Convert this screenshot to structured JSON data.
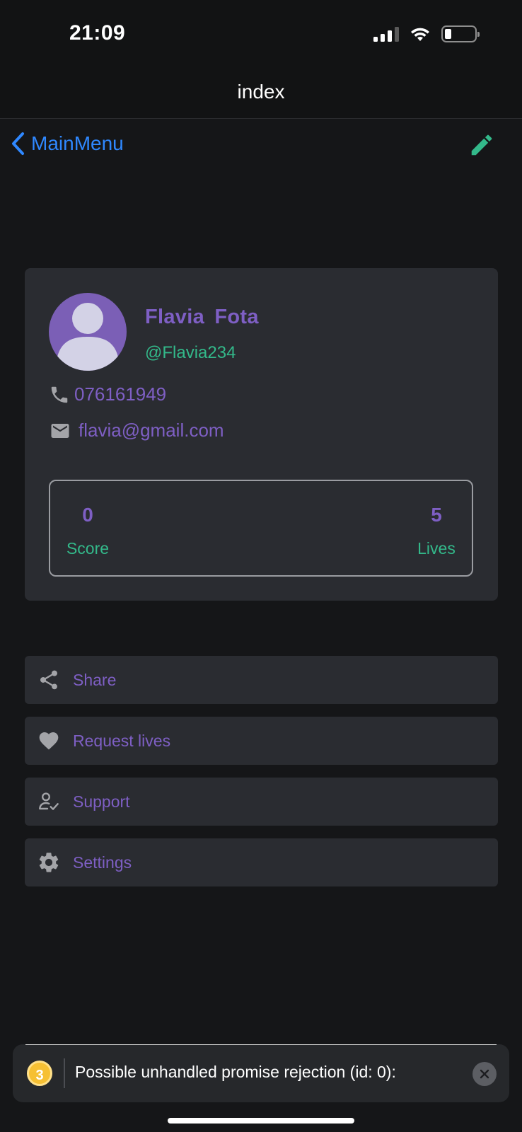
{
  "status_bar": {
    "time": "21:09",
    "icons": [
      "signal-icon",
      "wifi-icon",
      "battery-icon"
    ]
  },
  "nav": {
    "title": "index",
    "back_label": "MainMenu",
    "edit_icon": "pencil-icon",
    "colors": {
      "back": "#2f88ff",
      "edit": "#33b98a"
    }
  },
  "profile": {
    "first_name": "Flavia",
    "last_name": "Fota",
    "username": "@Flavia234",
    "phone": "076161949",
    "email": "flavia@gmail.com",
    "avatar_icon": "default-avatar-icon",
    "stats": {
      "score_value": "0",
      "score_label": "Score",
      "lives_value": "5",
      "lives_label": "Lives"
    },
    "colors": {
      "name": "#7e5fc4",
      "username": "#33b98a",
      "avatar_bg": "#7b5fb6"
    }
  },
  "menu": {
    "items": [
      {
        "label": "Share",
        "icon": "share-icon"
      },
      {
        "label": "Request lives",
        "icon": "heart-icon"
      },
      {
        "label": "Support",
        "icon": "support-user-check-icon"
      },
      {
        "label": "Settings",
        "icon": "gear-icon"
      }
    ]
  },
  "toast": {
    "count": "3",
    "message": "Possible unhandled promise rejection (id: 0):",
    "close_icon": "close-icon"
  }
}
